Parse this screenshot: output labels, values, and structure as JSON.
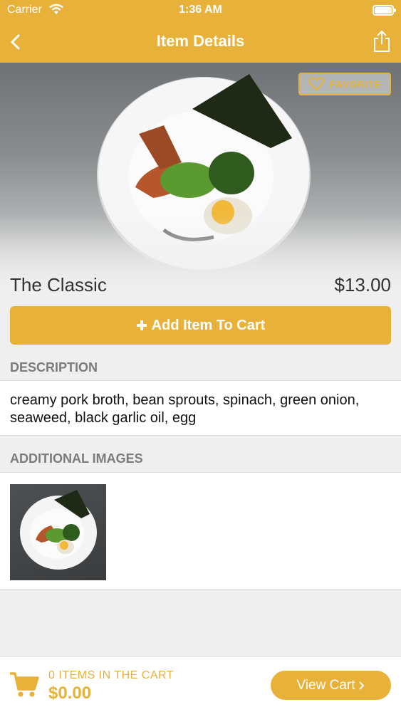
{
  "status_bar": {
    "carrier": "Carrier",
    "time": "1:36 AM"
  },
  "nav": {
    "title": "Item Details",
    "back_icon": "chevron-left-icon",
    "share_icon": "share-icon"
  },
  "item": {
    "favorite_label": "FAVORITE",
    "name": "The Classic",
    "price": "$13.00",
    "add_to_cart_label": "Add Item To Cart"
  },
  "description": {
    "header": "DESCRIPTION",
    "text": "creamy pork broth, bean sprouts, spinach, green onion, seaweed, black garlic oil, egg"
  },
  "additional_images": {
    "header": "ADDITIONAL IMAGES"
  },
  "cart": {
    "items_label": "0 ITEMS IN THE CART",
    "total": "$0.00",
    "view_cart_label": "View Cart"
  },
  "colors": {
    "accent": "#e8b13a",
    "background": "#efefef"
  }
}
